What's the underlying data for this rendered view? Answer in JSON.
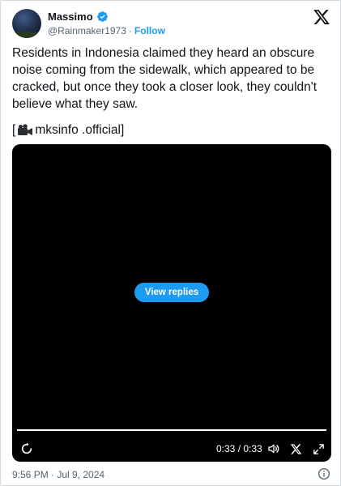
{
  "author": {
    "name": "Massimo",
    "handle": "@Rainmaker1973",
    "separator": "·",
    "follow_label": "Follow"
  },
  "tweet": {
    "text": "Residents in Indonesia claimed they heard an obscure noise coming from the sidewalk, which appeared to be cracked, but once they took a closer look, they couldn't believe what they saw.",
    "media_credit_open": "[",
    "media_credit_name": "mksinfo .official]"
  },
  "video": {
    "overlay_button": "View replies",
    "time_display": "0:33 / 0:33",
    "progress_fraction": 1.0
  },
  "footer": {
    "timestamp": "9:56 PM · Jul 9, 2024"
  },
  "icons": {
    "verified": "verified-badge-icon",
    "x_logo": "x-logo-icon",
    "replay": "replay-icon",
    "volume": "volume-icon",
    "x_small": "x-logo-small-icon",
    "fullscreen": "fullscreen-icon",
    "info": "info-icon",
    "camera": "video-camera-icon"
  },
  "colors": {
    "accent": "#1d9bf0",
    "text": "#0f1419",
    "muted": "#536471"
  }
}
